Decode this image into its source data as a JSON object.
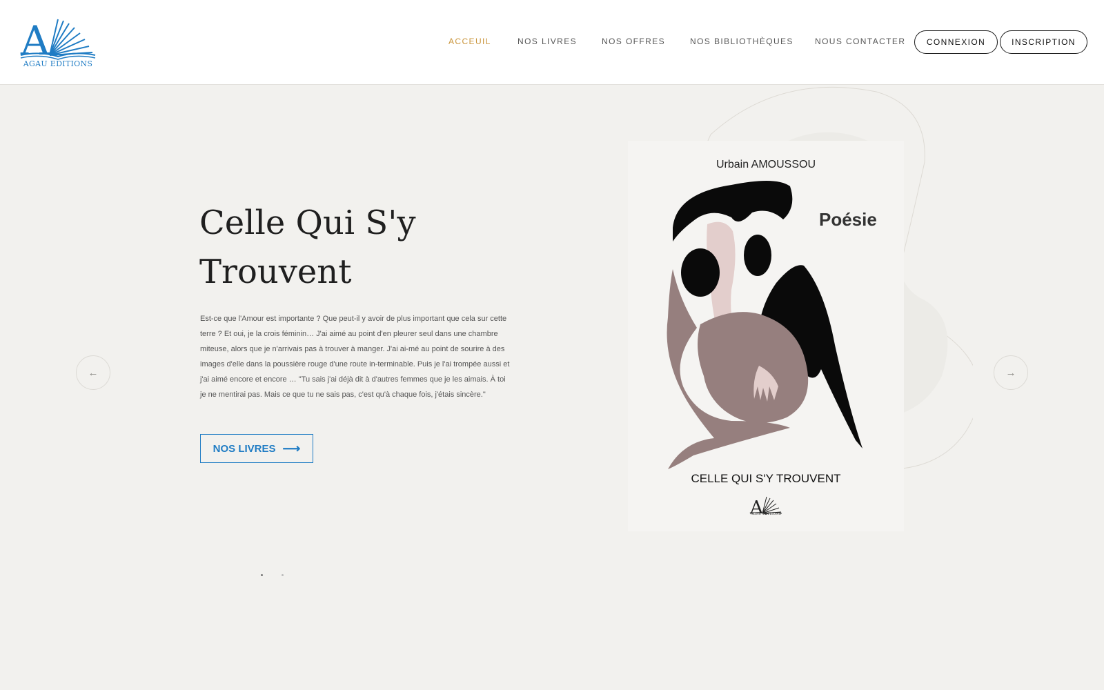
{
  "brand": {
    "name": "AGAU EDITIONS",
    "color": "#1f7cc4"
  },
  "nav": {
    "items": [
      {
        "label": "ACCEUIL",
        "active": true
      },
      {
        "label": "NOS LIVRES",
        "active": false
      },
      {
        "label": "NOS OFFRES",
        "active": false
      },
      {
        "label": "NOS BIBLIOTHÈQUES",
        "active": false
      },
      {
        "label": "NOUS CONTACTER",
        "active": false
      }
    ],
    "login_label": "CONNEXION",
    "signup_label": "INSCRIPTION",
    "active_color": "#c9943a"
  },
  "hero": {
    "title_line1": "Celle Qui S'y",
    "title_line2": "Trouvent",
    "description": "Est-ce que l'Amour est importante ? Que peut-il y avoir de plus important que cela sur cette terre ? Et oui, je la crois féminin… J'ai aimé au point d'en pleurer seul dans une chambre miteuse, alors que je n'arrivais pas à trouver à manger. J'ai ai-mé au point de sourire à des images d'elle dans la poussière rouge d'une route in-terminable. Puis je l'ai trompée aussi et j'ai aimé encore et encore … \"Tu sais j'ai déjà dit à d'autres femmes que je les aimais. À toi je ne mentirai pas. Mais ce que tu ne sais pas, c'est qu'à chaque fois, j'étais sincère.\"",
    "cta_label": "NOS LIVRES",
    "cta_icon": "arrow-right-icon"
  },
  "slider": {
    "prev_icon": "arrow-left-icon",
    "next_icon": "arrow-right-icon",
    "active_slide": 1,
    "slide_count": 2
  },
  "cover": {
    "author": "Urbain AMOUSSOU",
    "genre": "Poésie",
    "title": "CELLE QUI S'Y TROUVENT",
    "publisher": "AGAU EDITIONS"
  }
}
